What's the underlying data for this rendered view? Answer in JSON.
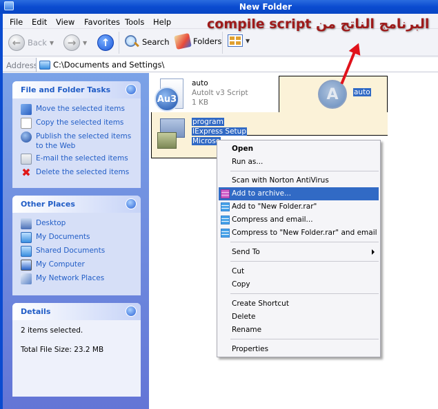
{
  "window": {
    "title": "New Folder"
  },
  "menu": [
    "File",
    "Edit",
    "View",
    "Favorites",
    "Tools",
    "Help"
  ],
  "toolbar": {
    "back": "Back",
    "search": "Search",
    "folders": "Folders"
  },
  "address": {
    "label": "Address",
    "path": "C:\\Documents and Settings\\"
  },
  "annotation": {
    "text": "البرنامج الناتج من compile script",
    "color": "#9e1a1a"
  },
  "sidebar": {
    "file_tasks": {
      "title": "File and Folder Tasks",
      "items": [
        "Move the selected items",
        "Copy the selected items",
        "Publish the selected items to the Web",
        "E-mail the selected items",
        "Delete the selected items"
      ]
    },
    "other_places": {
      "title": "Other Places",
      "items": [
        "Desktop",
        "My Documents",
        "Shared Documents",
        "My Computer",
        "My Network Places"
      ]
    },
    "details": {
      "title": "Details",
      "selected": "2 items selected.",
      "size": "Total File Size: 23.2 MB"
    }
  },
  "files": [
    {
      "name": "auto",
      "type": "AutoIt v3 Script",
      "size": "1 KB",
      "selected": false
    },
    {
      "name": "program",
      "type": "IExpress Setup",
      "extra": "Microso",
      "selected": true
    }
  ],
  "drag_ghost": {
    "label": "auto"
  },
  "context_menu": {
    "items": [
      {
        "label": "Open",
        "bold": true
      },
      {
        "label": "Run as..."
      },
      {
        "label": "Scan with Norton AntiVirus"
      },
      {
        "label": "Add to archive...",
        "highlighted": true,
        "icon": "winrar-icon"
      },
      {
        "label": "Add to \"New Folder.rar\"",
        "icon": "winrar-icon"
      },
      {
        "label": "Compress and email...",
        "icon": "winrar-icon"
      },
      {
        "label": "Compress to \"New Folder.rar\" and email",
        "icon": "winrar-icon"
      },
      {
        "label": "Send To",
        "submenu": true
      },
      {
        "label": "Cut"
      },
      {
        "label": "Copy"
      },
      {
        "label": "Create Shortcut"
      },
      {
        "label": "Delete"
      },
      {
        "label": "Rename"
      },
      {
        "label": "Properties"
      }
    ]
  }
}
